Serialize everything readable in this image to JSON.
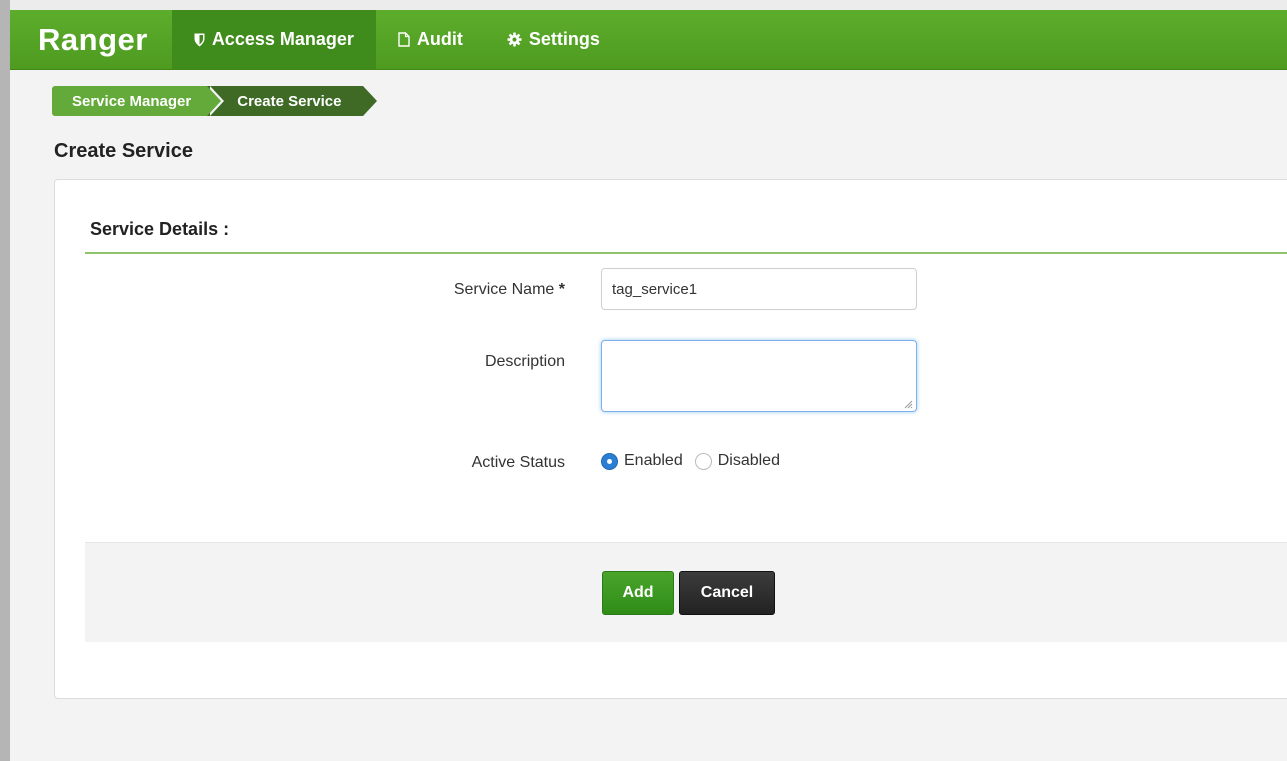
{
  "navbar": {
    "brand": "Ranger",
    "items": [
      {
        "label": "Access Manager",
        "icon": "shield-icon",
        "active": true
      },
      {
        "label": "Audit",
        "icon": "file-icon",
        "active": false
      },
      {
        "label": "Settings",
        "icon": "gear-icon",
        "active": false
      }
    ],
    "colors": {
      "bar": "#4e9b20",
      "active": "#3f8b1b"
    }
  },
  "breadcrumb": [
    "Service Manager",
    "Create Service"
  ],
  "page_title": "Create Service",
  "form": {
    "section_title": "Service Details :",
    "service_name": {
      "label": "Service Name",
      "required_mark": "*",
      "value": "tag_service1"
    },
    "description": {
      "label": "Description",
      "value": ""
    },
    "active_status": {
      "label": "Active Status",
      "options": [
        {
          "label": "Enabled",
          "checked": true
        },
        {
          "label": "Disabled",
          "checked": false
        }
      ]
    }
  },
  "buttons": {
    "add": "Add",
    "cancel": "Cancel"
  }
}
